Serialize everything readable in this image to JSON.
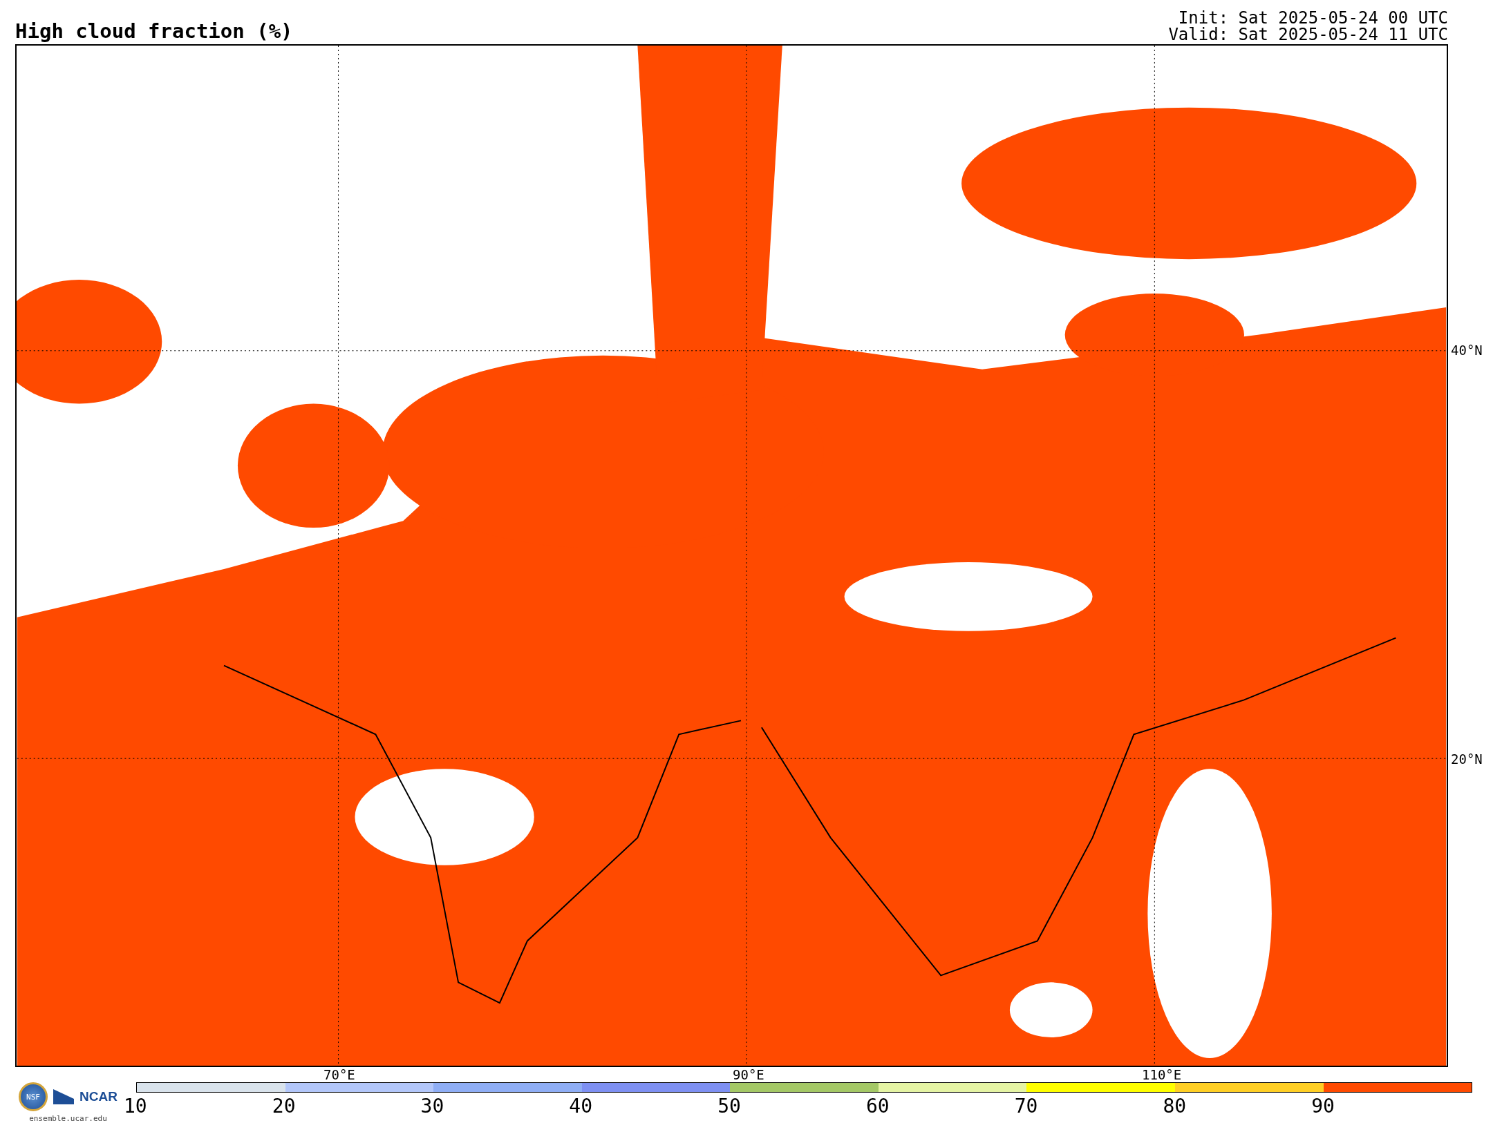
{
  "title": "High cloud fraction (%)",
  "init": "Init: Sat 2025-05-24 00 UTC",
  "valid": "Valid: Sat 2025-05-24 11 UTC",
  "map": {
    "longitudes": [
      {
        "label": "70°E"
      },
      {
        "label": "90°E"
      },
      {
        "label": "110°E"
      }
    ],
    "latitudes": [
      {
        "label": "40°N"
      },
      {
        "label": "20°N"
      }
    ]
  },
  "colorbar": {
    "ticks": [
      "10",
      "20",
      "30",
      "40",
      "50",
      "60",
      "70",
      "80",
      "90"
    ],
    "bins": [
      {
        "color": "#d9e3ec"
      },
      {
        "color": "#b3c7fa"
      },
      {
        "color": "#8faef5"
      },
      {
        "color": "#7e90f2"
      },
      {
        "color": "#a4c866"
      },
      {
        "color": "#e5f4a4"
      },
      {
        "color": "#ffff00"
      },
      {
        "color": "#ffcf25"
      },
      {
        "color": "#ff4a00"
      }
    ]
  },
  "logo": {
    "nsf": "NSF",
    "ncar": "NCAR",
    "site": "ensemble.ucar.edu"
  }
}
